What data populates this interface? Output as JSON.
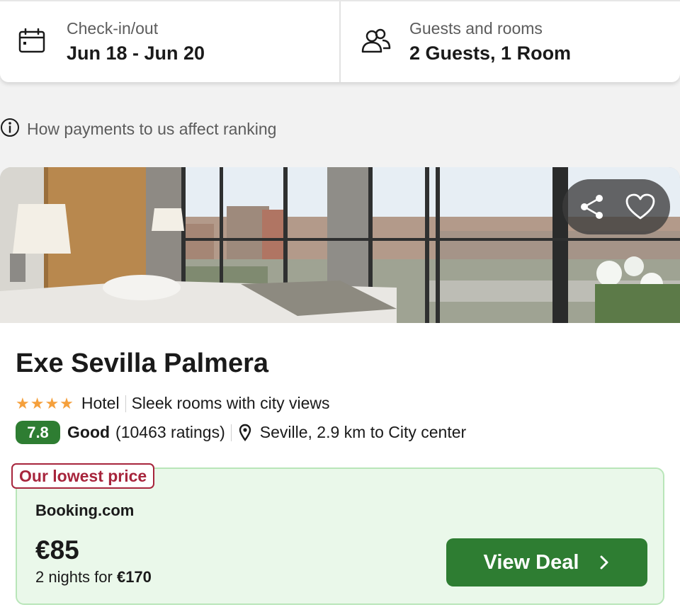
{
  "search": {
    "checkin_label": "Check-in/out",
    "checkin_value": "Jun 18 - Jun 20",
    "guests_label": "Guests and rooms",
    "guests_value": "2 Guests, 1 Room"
  },
  "ranking_info": "How payments to us affect ranking",
  "hotel": {
    "name": "Exe Sevilla Palmera",
    "stars": "★★★★",
    "star_count": 4,
    "type": "Hotel",
    "tagline": "Sleek rooms with city views",
    "score": "7.8",
    "rating_word": "Good",
    "rating_count": "(10463 ratings)",
    "location": "Seville, 2.9 km to City center"
  },
  "deal": {
    "badge": "Our lowest price",
    "provider": "Booking.com",
    "price": "€85",
    "nights_prefix": "2 nights for ",
    "nights_total": "€170",
    "button_label": "View Deal"
  },
  "icons": {
    "calendar": "calendar-icon",
    "guests": "users-icon",
    "info": "info-icon",
    "share": "share-icon",
    "favorite": "heart-icon",
    "location": "map-pin-icon",
    "chevron": "chevron-right-icon"
  },
  "colors": {
    "accent_green": "#2e7d32",
    "deal_bg": "#eaf8ea",
    "badge_red": "#a7253c",
    "stars": "#f5a03c"
  }
}
